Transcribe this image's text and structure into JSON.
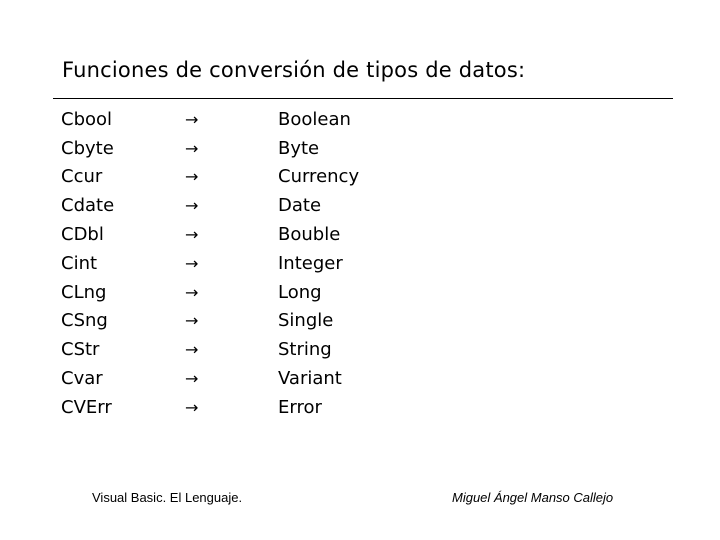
{
  "title": "Funciones de conversión de tipos de datos:",
  "arrow": "→",
  "rows": [
    {
      "function": "Cbool",
      "type": "Boolean"
    },
    {
      "function": "Cbyte",
      "type": "Byte"
    },
    {
      "function": "Ccur",
      "type": "Currency"
    },
    {
      "function": "Cdate",
      "type": "Date"
    },
    {
      "function": "CDbl",
      "type": "Bouble"
    },
    {
      "function": "Cint",
      "type": "Integer"
    },
    {
      "function": "CLng",
      "type": "Long"
    },
    {
      "function": "CSng",
      "type": "Single"
    },
    {
      "function": "CStr",
      "type": "String"
    },
    {
      "function": "Cvar",
      "type": "Variant"
    },
    {
      "function": "CVErr",
      "type": "Error"
    }
  ],
  "footer": {
    "left": "Visual Basic. El Lenguaje.",
    "right": "Miguel Ángel Manso Callejo"
  }
}
